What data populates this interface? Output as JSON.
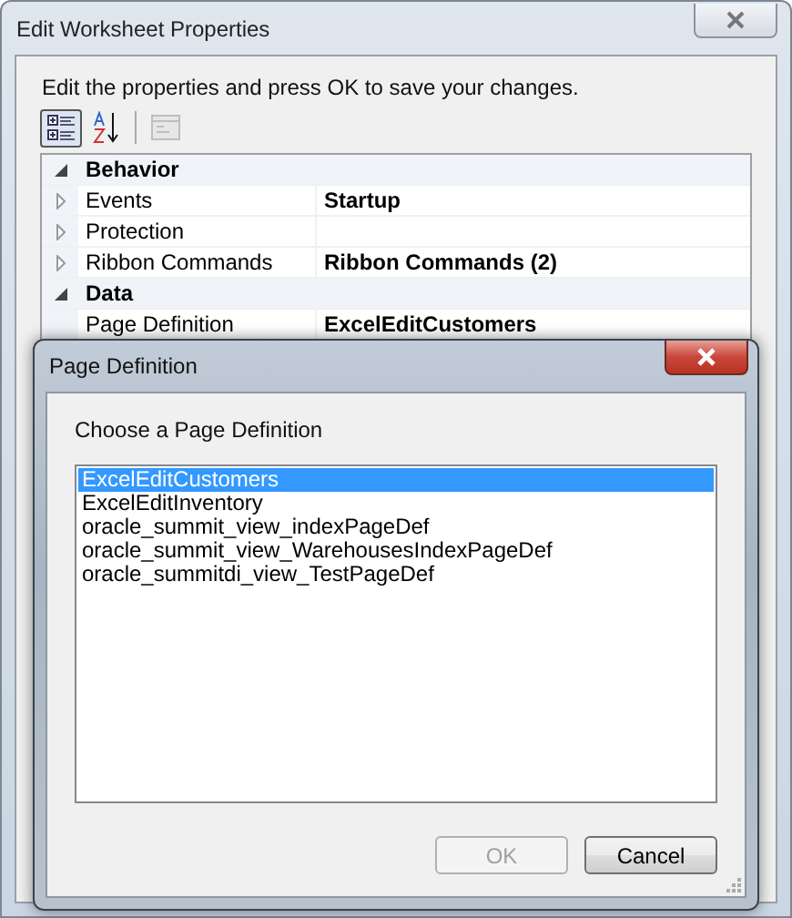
{
  "window": {
    "title": "Edit Worksheet Properties"
  },
  "instruction": "Edit the properties and press OK to save your changes.",
  "toolbar": [
    {
      "kind": "categorized",
      "selected": true,
      "disabled": false
    },
    {
      "kind": "alphabetical",
      "selected": false,
      "disabled": false
    },
    {
      "kind": "property-pages",
      "selected": false,
      "disabled": true
    }
  ],
  "property_grid": [
    {
      "label": "Behavior",
      "expanded": true,
      "properties": [
        {
          "name": "Events",
          "value": "Startup",
          "expandable": true
        },
        {
          "name": "Protection",
          "expandable": true
        },
        {
          "name": "Ribbon Commands",
          "value": "Ribbon Commands (2)",
          "expandable": true
        }
      ]
    },
    {
      "label": "Data",
      "expanded": true,
      "properties": [
        {
          "name": "Page Definition",
          "value": "ExcelEditCustomers",
          "expandable": false
        }
      ]
    }
  ],
  "dialog": {
    "title": "Page Definition",
    "prompt": "Choose a Page Definition",
    "items": [
      {
        "label": "ExcelEditCustomers",
        "selected": true
      },
      {
        "label": "ExcelEditInventory",
        "selected": false
      },
      {
        "label": "oracle_summit_view_indexPageDef",
        "selected": false
      },
      {
        "label": "oracle_summit_view_WarehousesIndexPageDef",
        "selected": false
      },
      {
        "label": "oracle_summitdi_view_TestPageDef",
        "selected": false
      }
    ],
    "buttons": [
      {
        "label": "OK",
        "disabled": true
      },
      {
        "label": "Cancel",
        "disabled": false
      }
    ]
  }
}
